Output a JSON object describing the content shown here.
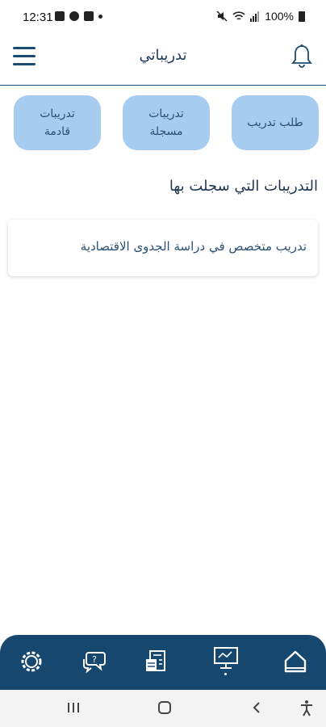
{
  "status_bar": {
    "time": "12:31",
    "battery": "100%"
  },
  "app_bar": {
    "title": "تدريباتي"
  },
  "tabs": [
    {
      "line1": "طلب تدريب",
      "line2": ""
    },
    {
      "line1": "تدريبات",
      "line2": "مسجلة"
    },
    {
      "line1": "تدريبات",
      "line2": "قادمة"
    }
  ],
  "section": {
    "title": "التدريبات التي سجلت بها"
  },
  "trainings": [
    {
      "name": "تدريب متخصص في دراسة الجدوى الاقتصادية"
    }
  ],
  "bottom_nav": {
    "items": [
      "home-icon",
      "monitor-icon",
      "report-icon",
      "chat-icon",
      "settings-icon"
    ]
  },
  "colors": {
    "primary": "#16476e",
    "tab_bg": "#a6cdf0",
    "text": "#1f3550"
  }
}
